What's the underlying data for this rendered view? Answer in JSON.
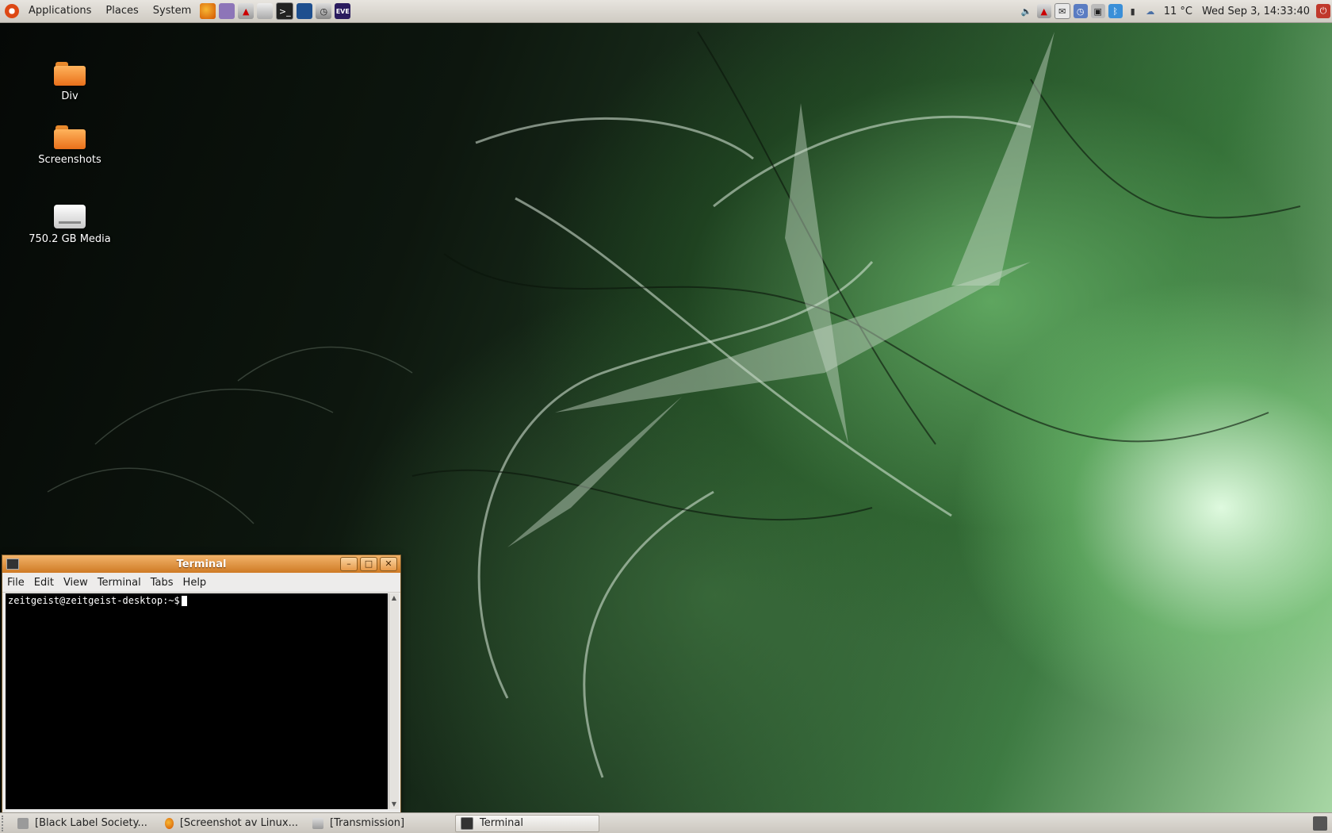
{
  "top_panel": {
    "menus": [
      "Applications",
      "Places",
      "System"
    ],
    "launchers": [
      "firefox-icon",
      "pidgin-icon",
      "transmission-icon",
      "media-icon",
      "terminal-icon",
      "network-icon",
      "clock-app-icon",
      "eve-icon"
    ],
    "eve_label": "EVE",
    "weather": "11 °C",
    "clock": "Wed Sep  3, 14:33:40"
  },
  "desktop_icons": [
    {
      "label": "Div",
      "icon": "folder-icon"
    },
    {
      "label": "Screenshots",
      "icon": "folder-icon"
    },
    {
      "label": "750.2 GB Media",
      "icon": "drive-icon"
    }
  ],
  "terminal": {
    "title": "Terminal",
    "menu": [
      "File",
      "Edit",
      "View",
      "Terminal",
      "Tabs",
      "Help"
    ],
    "prompt": "zeitgeist@zeitgeist-desktop:~$",
    "buttons": {
      "minimize": "–",
      "maximize": "□",
      "close": "✕"
    }
  },
  "taskbar": {
    "tasks": [
      {
        "label": "[Black Label Society...",
        "icon": "music-icon",
        "active": false
      },
      {
        "label": "[Screenshot av Linux...",
        "icon": "firefox-icon",
        "active": false
      },
      {
        "label": "[Transmission]",
        "icon": "transmission-icon",
        "active": false
      },
      {
        "label": "Terminal",
        "icon": "terminal-icon",
        "active": true
      }
    ]
  },
  "colors": {
    "panel": "#dcd8d1",
    "title_orange": "#e08a32",
    "terminal_bg": "#000000",
    "terminal_fg": "#ffffff"
  }
}
